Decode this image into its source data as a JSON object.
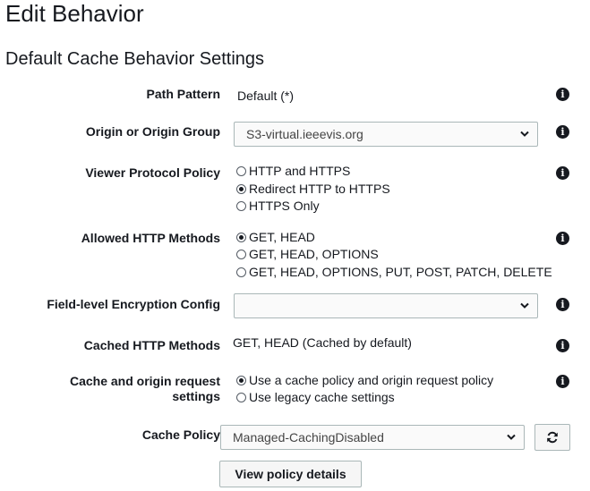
{
  "page_title": "Edit Behavior",
  "section_title": "Default Cache Behavior Settings",
  "path_pattern": {
    "label": "Path Pattern",
    "value": "Default (*)"
  },
  "origin": {
    "label": "Origin or Origin Group",
    "value": "S3-virtual.ieeevis.org"
  },
  "viewer_protocol": {
    "label": "Viewer Protocol Policy",
    "options": [
      "HTTP and HTTPS",
      "Redirect HTTP to HTTPS",
      "HTTPS Only"
    ],
    "selected": "Redirect HTTP to HTTPS"
  },
  "allowed_methods": {
    "label": "Allowed HTTP Methods",
    "options": [
      "GET, HEAD",
      "GET, HEAD, OPTIONS",
      "GET, HEAD, OPTIONS, PUT, POST, PATCH, DELETE"
    ],
    "selected": "GET, HEAD"
  },
  "field_encryption": {
    "label": "Field-level Encryption Config",
    "value": ""
  },
  "cached_methods": {
    "label": "Cached HTTP Methods",
    "value": "GET, HEAD (Cached by default)"
  },
  "cache_origin_settings": {
    "label_line1": "Cache and origin request",
    "label_line2": "settings",
    "options": [
      "Use a cache policy and origin request policy",
      "Use legacy cache settings"
    ],
    "selected": "Use a cache policy and origin request policy"
  },
  "cache_policy": {
    "label": "Cache Policy",
    "value": "Managed-CachingDisabled"
  },
  "view_policy_button": "View policy details",
  "info_glyph": "i"
}
